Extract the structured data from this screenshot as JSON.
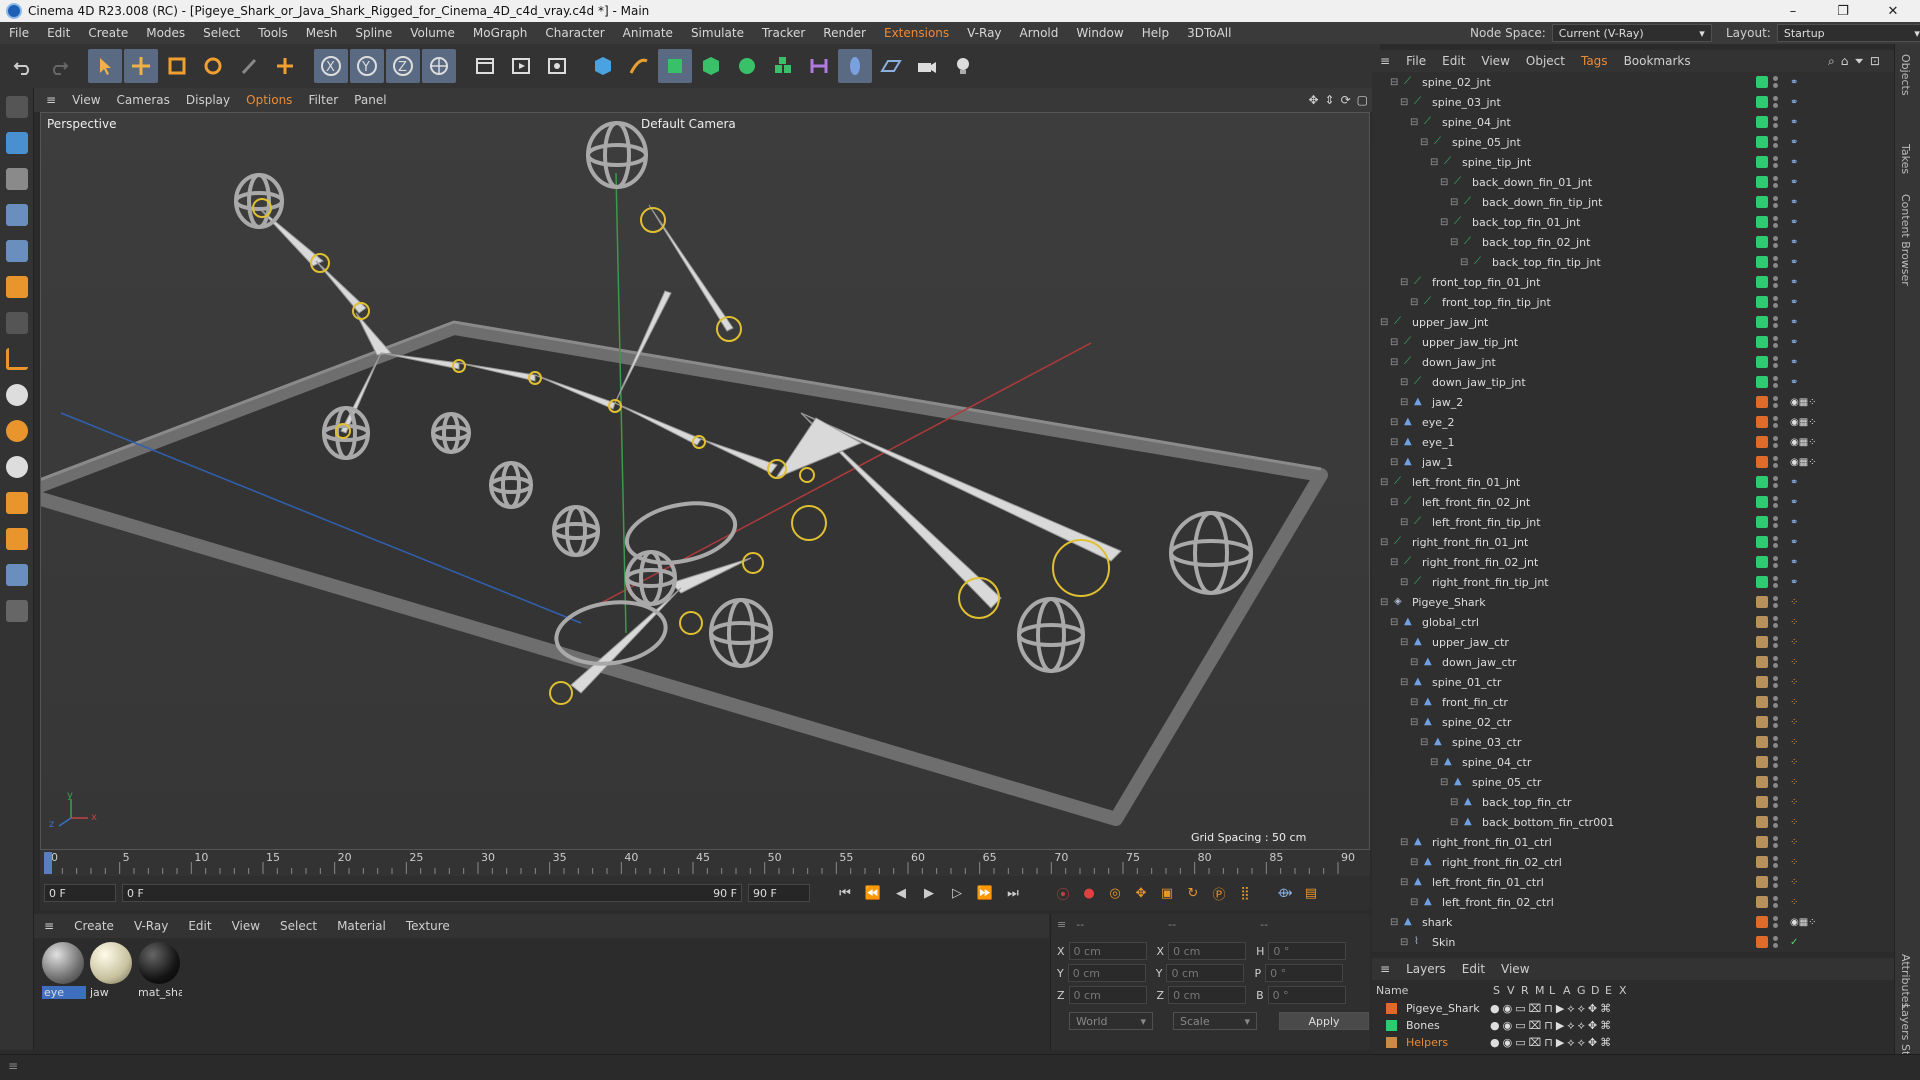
{
  "window": {
    "title": "Cinema 4D R23.008 (RC) - [Pigeye_Shark_or_Java_Shark_Rigged_for_Cinema_4D_c4d_vray.c4d *] - Main",
    "minimize": "–",
    "maximize": "❐",
    "close": "✕"
  },
  "menubar": {
    "items": [
      "File",
      "Edit",
      "Create",
      "Modes",
      "Select",
      "Tools",
      "Mesh",
      "Spline",
      "Volume",
      "MoGraph",
      "Character",
      "Animate",
      "Simulate",
      "Tracker",
      "Render",
      "Extensions",
      "V-Ray",
      "Arnold",
      "Window",
      "Help",
      "3DToAll"
    ],
    "node_space_label": "Node Space:",
    "node_space_value": "Current (V-Ray)",
    "layout_label": "Layout:",
    "layout_value": "Startup"
  },
  "toolbar": {
    "icons": [
      "undo-icon",
      "redo-icon",
      "select-icon",
      "move-icon",
      "scale-icon",
      "rotate-icon",
      "live-select-icon",
      "add-icon",
      "x-axis-icon",
      "y-axis-icon",
      "z-axis-icon",
      "world-coords-icon",
      "render-region-icon",
      "render-view-icon",
      "render-settings-icon",
      "cube-icon",
      "pen-icon",
      "subdivision-icon",
      "extrude-icon",
      "cloner-icon",
      "mograph-icon",
      "deformer-icon",
      "spline-brush-icon",
      "floor-icon",
      "camera-icon",
      "light-icon"
    ]
  },
  "viewport": {
    "menu": [
      "View",
      "Cameras",
      "Display",
      "Options",
      "Filter",
      "Panel"
    ],
    "name": "Perspective",
    "camera": "Default Camera",
    "grid_spacing": "Grid Spacing : 50 cm",
    "axis_x": "x",
    "axis_y": "y",
    "axis_z": "z"
  },
  "timeline": {
    "ticks": [
      "0",
      "5",
      "10",
      "15",
      "20",
      "25",
      "30",
      "35",
      "40",
      "45",
      "50",
      "55",
      "60",
      "65",
      "70",
      "75",
      "80",
      "85",
      "90"
    ],
    "current_frame": "0 F",
    "start_frame": "0 F",
    "range_start": "0 F",
    "range_end": "90 F",
    "end_frame": "90 F",
    "right_frame": "0 F"
  },
  "material_manager": {
    "menu": [
      "Create",
      "V-Ray",
      "Edit",
      "View",
      "Select",
      "Material",
      "Texture"
    ],
    "materials": [
      {
        "name": "eye",
        "color": "#9a9a9a"
      },
      {
        "name": "jaw",
        "color": "#d6d2b8"
      },
      {
        "name": "mat_sha",
        "color": "#1a1a1a"
      }
    ]
  },
  "coordinates": {
    "header_left": "--",
    "header_mid": "--",
    "header_right": "--",
    "rows": [
      {
        "a": "X",
        "av": "0 cm",
        "b": "X",
        "bv": "0 cm",
        "c": "H",
        "cv": "0 °"
      },
      {
        "a": "Y",
        "av": "0 cm",
        "b": "Y",
        "bv": "0 cm",
        "c": "P",
        "cv": "0 °"
      },
      {
        "a": "Z",
        "av": "0 cm",
        "b": "Z",
        "bv": "0 cm",
        "c": "B",
        "cv": "0 °"
      }
    ],
    "mode": "World",
    "transform": "Scale",
    "apply": "Apply"
  },
  "object_manager": {
    "menu": [
      "File",
      "Edit",
      "View",
      "Object",
      "Tags",
      "Bookmarks"
    ],
    "objects": [
      {
        "name": "spine_02_jnt",
        "depth": 2,
        "kind": "joint",
        "color": "#2ecc71"
      },
      {
        "name": "spine_03_jnt",
        "depth": 3,
        "kind": "joint",
        "color": "#2ecc71"
      },
      {
        "name": "spine_04_jnt",
        "depth": 4,
        "kind": "joint",
        "color": "#2ecc71"
      },
      {
        "name": "spine_05_jnt",
        "depth": 5,
        "kind": "joint",
        "color": "#2ecc71"
      },
      {
        "name": "spine_tip_jnt",
        "depth": 6,
        "kind": "joint",
        "color": "#2ecc71"
      },
      {
        "name": "back_down_fin_01_jnt",
        "depth": 7,
        "kind": "joint",
        "color": "#2ecc71"
      },
      {
        "name": "back_down_fin_tip_jnt",
        "depth": 8,
        "kind": "joint",
        "color": "#2ecc71"
      },
      {
        "name": "back_top_fin_01_jnt",
        "depth": 7,
        "kind": "joint",
        "color": "#2ecc71"
      },
      {
        "name": "back_top_fin_02_jnt",
        "depth": 8,
        "kind": "joint",
        "color": "#2ecc71"
      },
      {
        "name": "back_top_fin_tip_jnt",
        "depth": 9,
        "kind": "joint",
        "color": "#2ecc71"
      },
      {
        "name": "front_top_fin_01_jnt",
        "depth": 3,
        "kind": "joint",
        "color": "#2ecc71"
      },
      {
        "name": "front_top_fin_tip_jnt",
        "depth": 4,
        "kind": "joint",
        "color": "#2ecc71"
      },
      {
        "name": "upper_jaw_jnt",
        "depth": 1,
        "kind": "joint",
        "color": "#2ecc71"
      },
      {
        "name": "upper_jaw_tip_jnt",
        "depth": 2,
        "kind": "joint",
        "color": "#2ecc71"
      },
      {
        "name": "down_jaw_jnt",
        "depth": 2,
        "kind": "joint",
        "color": "#2ecc71"
      },
      {
        "name": "down_jaw_tip_jnt",
        "depth": 3,
        "kind": "joint",
        "color": "#2ecc71"
      },
      {
        "name": "jaw_2",
        "depth": 3,
        "kind": "mesh",
        "color": "#e06a2a"
      },
      {
        "name": "eye_2",
        "depth": 2,
        "kind": "mesh",
        "color": "#e06a2a"
      },
      {
        "name": "eye_1",
        "depth": 2,
        "kind": "mesh",
        "color": "#e06a2a"
      },
      {
        "name": "jaw_1",
        "depth": 2,
        "kind": "mesh",
        "color": "#e06a2a"
      },
      {
        "name": "left_front_fin_01_jnt",
        "depth": 1,
        "kind": "joint",
        "color": "#2ecc71"
      },
      {
        "name": "left_front_fin_02_jnt",
        "depth": 2,
        "kind": "joint",
        "color": "#2ecc71"
      },
      {
        "name": "left_front_fin_tip_jnt",
        "depth": 3,
        "kind": "joint",
        "color": "#2ecc71"
      },
      {
        "name": "right_front_fin_01_jnt",
        "depth": 1,
        "kind": "joint",
        "color": "#2ecc71"
      },
      {
        "name": "right_front_fin_02_jnt",
        "depth": 2,
        "kind": "joint",
        "color": "#2ecc71"
      },
      {
        "name": "right_front_fin_tip_jnt",
        "depth": 3,
        "kind": "joint",
        "color": "#2ecc71"
      },
      {
        "name": "Pigeye_Shark",
        "depth": 1,
        "kind": "null",
        "color": "#b8915a"
      },
      {
        "name": "global_ctrl",
        "depth": 2,
        "kind": "ctrl",
        "color": "#b8915a"
      },
      {
        "name": "upper_jaw_ctr",
        "depth": 3,
        "kind": "ctrl",
        "color": "#b8915a"
      },
      {
        "name": "down_jaw_ctr",
        "depth": 4,
        "kind": "ctrl",
        "color": "#b8915a"
      },
      {
        "name": "spine_01_ctr",
        "depth": 3,
        "kind": "ctrl",
        "color": "#b8915a"
      },
      {
        "name": "front_fin_ctr",
        "depth": 4,
        "kind": "ctrl",
        "color": "#b8915a"
      },
      {
        "name": "spine_02_ctr",
        "depth": 4,
        "kind": "ctrl",
        "color": "#b8915a"
      },
      {
        "name": "spine_03_ctr",
        "depth": 5,
        "kind": "ctrl",
        "color": "#b8915a"
      },
      {
        "name": "spine_04_ctr",
        "depth": 6,
        "kind": "ctrl",
        "color": "#b8915a"
      },
      {
        "name": "spine_05_ctr",
        "depth": 7,
        "kind": "ctrl",
        "color": "#b8915a"
      },
      {
        "name": "back_top_fin_ctr",
        "depth": 8,
        "kind": "ctrl",
        "color": "#b8915a"
      },
      {
        "name": "back_bottom_fin_ctr001",
        "depth": 8,
        "kind": "ctrl",
        "color": "#b8915a"
      },
      {
        "name": "right_front_fin_01_ctrl",
        "depth": 3,
        "kind": "ctrl",
        "color": "#b8915a"
      },
      {
        "name": "right_front_fin_02_ctrl",
        "depth": 4,
        "kind": "ctrl",
        "color": "#b8915a"
      },
      {
        "name": "left_front_fin_01_ctrl",
        "depth": 3,
        "kind": "ctrl",
        "color": "#b8915a"
      },
      {
        "name": "left_front_fin_02_ctrl",
        "depth": 4,
        "kind": "ctrl",
        "color": "#b8915a"
      },
      {
        "name": "shark",
        "depth": 2,
        "kind": "mesh",
        "color": "#e06a2a"
      },
      {
        "name": "Skin",
        "depth": 3,
        "kind": "skin",
        "color": "#e06a2a"
      }
    ]
  },
  "right_tabs": [
    "Objects",
    "Takes",
    "Content Browser",
    "Attributes",
    "Layers",
    "Str"
  ],
  "layers": {
    "menu": [
      "Layers",
      "Edit",
      "View"
    ],
    "headers": [
      "Name",
      "S",
      "V",
      "R",
      "M",
      "L",
      "A",
      "G",
      "D",
      "E",
      "X"
    ],
    "rows": [
      {
        "name": "Pigeye_Shark",
        "color": "#e06a2a",
        "text_color": "#dddddd"
      },
      {
        "name": "Bones",
        "color": "#2ecc71",
        "text_color": "#dddddd"
      },
      {
        "name": "Helpers",
        "color": "#c98a4a",
        "text_color": "#e88c3a"
      }
    ]
  }
}
